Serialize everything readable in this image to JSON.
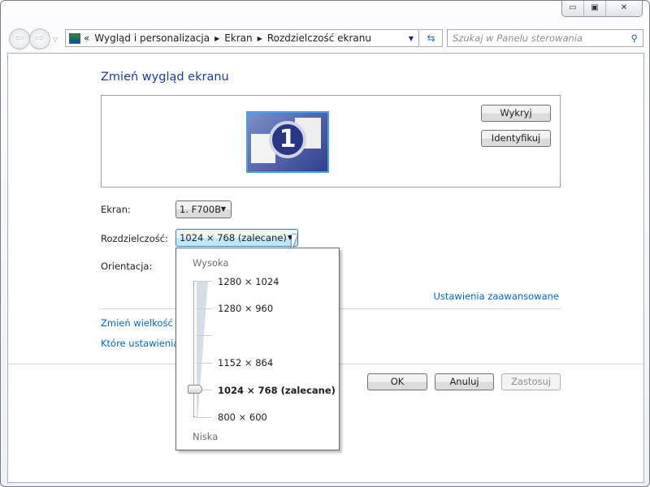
{
  "window": {
    "caption_buttons": [
      "minimize",
      "maximize",
      "close"
    ]
  },
  "address": {
    "crumbs": [
      "Wygląd i personalizacja",
      "Ekran",
      "Rozdzielczość ekranu"
    ],
    "overflow": "«"
  },
  "search": {
    "placeholder": "Szukaj w Panelu sterowania"
  },
  "main": {
    "title": "Zmień wygląd ekranu",
    "monitor_number": "1",
    "detect_label": "Wykryj",
    "identify_label": "Identyfikuj",
    "screen_label": "Ekran:",
    "screen_value": "1. F700B",
    "resolution_label": "Rozdzielczość:",
    "resolution_value": "1024 × 768 (zalecane)",
    "orientation_label": "Orientacja:",
    "advanced_link": "Ustawienia zaawansowane",
    "link1": "Zmień wielkość te",
    "link2": "Które ustawienia w",
    "ok": "OK",
    "cancel": "Anuluj",
    "apply": "Zastosuj"
  },
  "resolution_popup": {
    "high": "Wysoka",
    "low": "Niska",
    "options": [
      "1280 × 1024",
      "1280 × 960",
      "",
      "1152 × 864",
      "1024 × 768 (zalecane)",
      "800 × 600"
    ],
    "selected_index": 4
  }
}
